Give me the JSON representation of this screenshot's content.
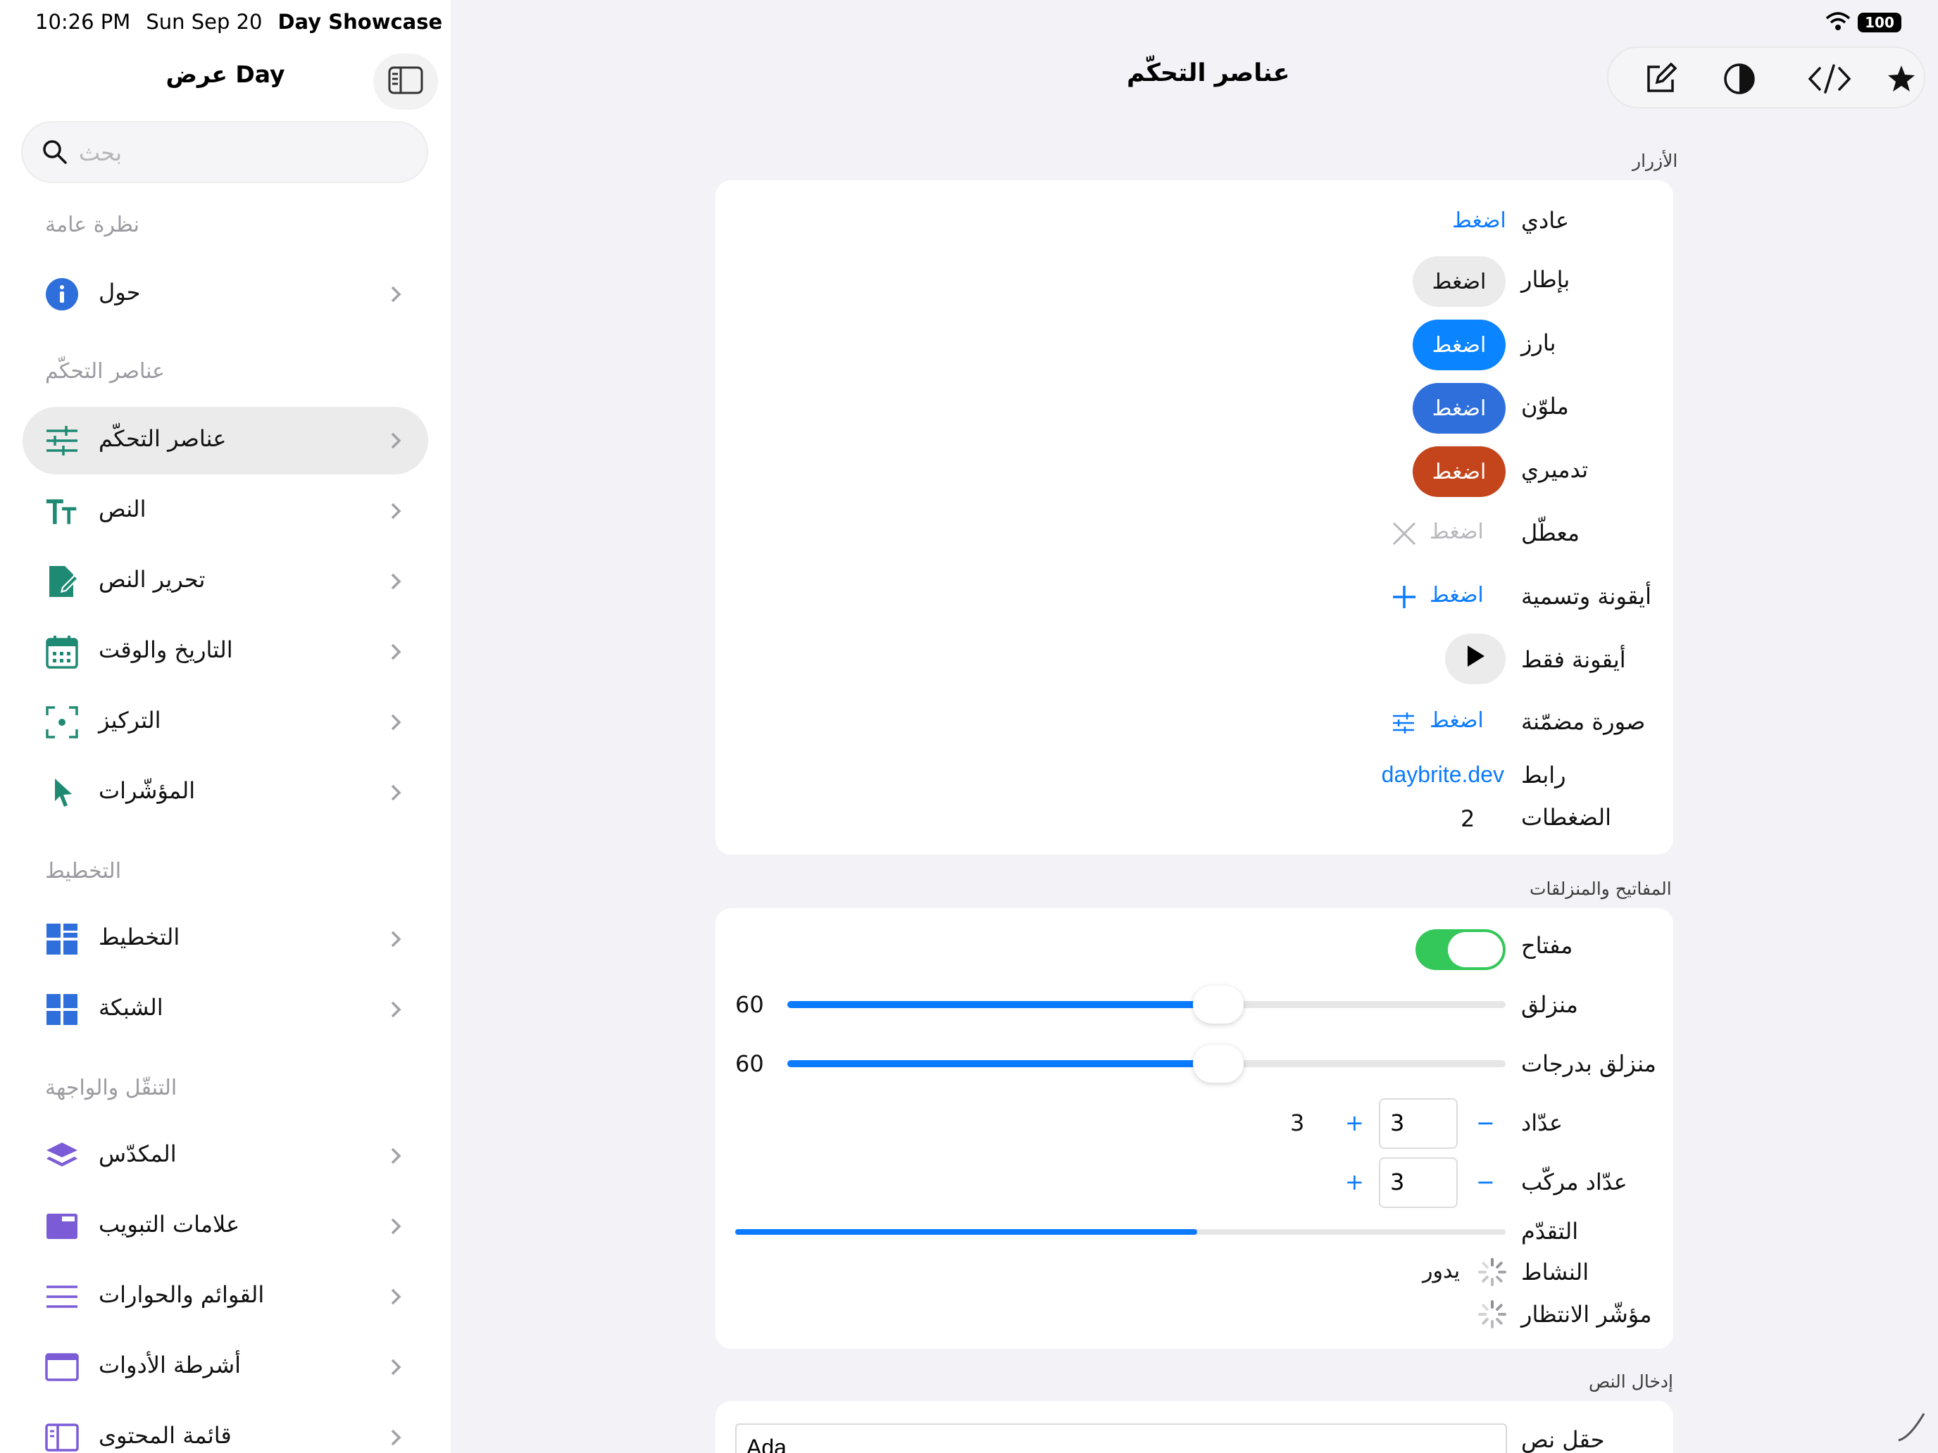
{
  "status_bar": {
    "time": "10:26 PM",
    "date": "Sun Sep 20",
    "app": "Day Showcase",
    "battery": "100"
  },
  "sidebar": {
    "title": "عرض Day",
    "search_placeholder": "بحث",
    "sections": {
      "overview": "نظرة عامة",
      "controls": "عناصر التحكّم",
      "layout": "التخطيط",
      "navigation": "التنقّل والواجهة"
    },
    "items": [
      {
        "label": "حول",
        "icon": "info-icon"
      },
      {
        "label": "عناصر التحكّم",
        "icon": "sliders-icon"
      },
      {
        "label": "النص",
        "icon": "text-size-icon"
      },
      {
        "label": "تحرير النص",
        "icon": "document-edit-icon"
      },
      {
        "label": "التاريخ والوقت",
        "icon": "calendar-icon"
      },
      {
        "label": "التركيز",
        "icon": "focus-icon"
      },
      {
        "label": "المؤشّرات",
        "icon": "pointer-icon"
      },
      {
        "label": "التخطيط",
        "icon": "layout-grid-icon"
      },
      {
        "label": "الشبكة",
        "icon": "grid-icon"
      },
      {
        "label": "المكدّس",
        "icon": "stack-icon"
      },
      {
        "label": "علامات التبويب",
        "icon": "tabs-icon"
      },
      {
        "label": "القوائم والحوارات",
        "icon": "menu-lines-icon"
      },
      {
        "label": "أشرطة الأدوات",
        "icon": "toolbar-icon"
      },
      {
        "label": "قائمة المحتوى",
        "icon": "sidebar-content-icon"
      }
    ]
  },
  "main": {
    "title": "عناصر التحكّم",
    "toolbar": [
      "compose-icon",
      "contrast-icon",
      "code-icon",
      "star-icon"
    ],
    "buttons_section": {
      "header": "الأزرار",
      "rows": {
        "plain": {
          "label": "عادي",
          "button": "اضغط"
        },
        "bordered": {
          "label": "بإطار",
          "button": "اضغط"
        },
        "prominent": {
          "label": "بارز",
          "button": "اضغط"
        },
        "tinted": {
          "label": "ملوّن",
          "button": "اضغط"
        },
        "destructive": {
          "label": "تدميري",
          "button": "اضغط"
        },
        "disabled": {
          "label": "معطّل",
          "button": "اضغط"
        },
        "icon_label": {
          "label": "أيقونة وتسمية",
          "button": "اضغط"
        },
        "icon_only": {
          "label": "أيقونة فقط"
        },
        "inline_image": {
          "label": "صورة مضمّنة",
          "button": "اضغط"
        },
        "link": {
          "label": "رابط",
          "value": "daybrite.dev"
        },
        "taps": {
          "label": "الضغطات",
          "value": "2"
        }
      }
    },
    "toggles_section": {
      "header": "المفاتيح والمنزلقات",
      "toggle": {
        "label": "مفتاح",
        "on": true
      },
      "slider": {
        "label": "منزلق",
        "value": "60",
        "fraction": 0.6
      },
      "stepped_slider": {
        "label": "منزلق بدرجات",
        "value": "60",
        "fraction": 0.6
      },
      "stepper": {
        "label": "عدّاد",
        "field": "3",
        "value": "3",
        "minus": "−",
        "plus": "+"
      },
      "compound_stepper": {
        "label": "عدّاد مركّب",
        "field": "3",
        "minus": "−",
        "plus": "+"
      },
      "progress": {
        "label": "التقدّم",
        "fraction": 0.6
      },
      "activity": {
        "label": "النشاط",
        "status": "يدور"
      },
      "wait_indicator": {
        "label": "مؤشّر الانتظار"
      }
    },
    "text_input_section": {
      "header": "إدخال النص",
      "text_field": {
        "label": "حقل نص",
        "value": "Ada"
      }
    }
  },
  "colors": {
    "accent": "#0a7aff",
    "prominent": "#0a84ff",
    "tinted": "#2f6fdb",
    "destructive": "#c4451c",
    "toggle_on": "#34c759"
  }
}
